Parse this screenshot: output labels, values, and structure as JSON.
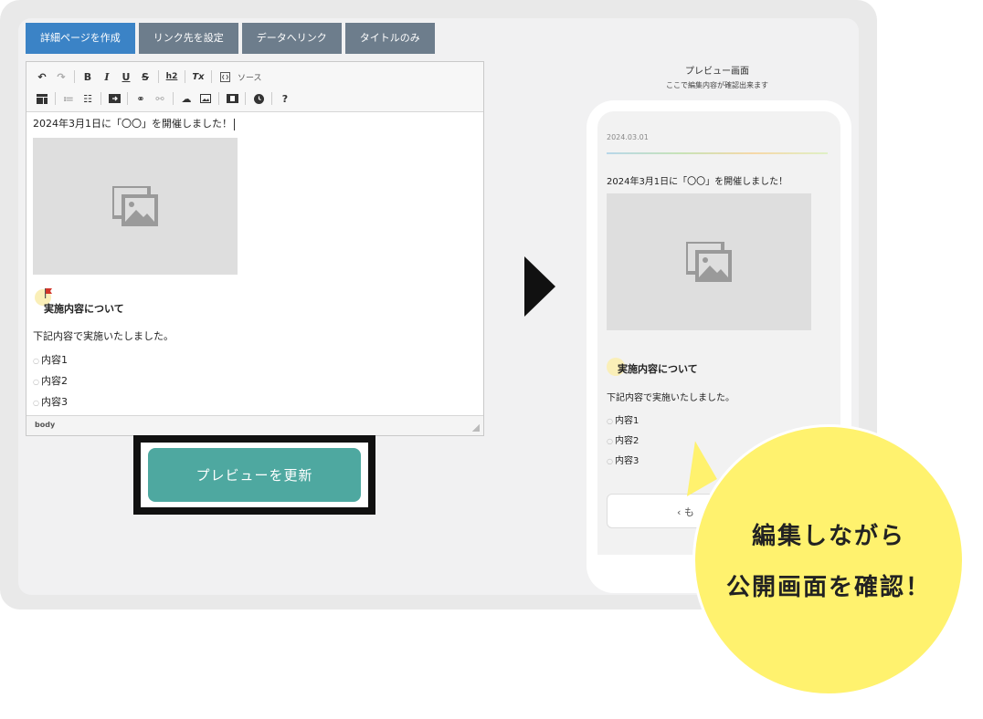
{
  "tabs": [
    {
      "label": "詳細ページを作成",
      "active": true
    },
    {
      "label": "リンク先を設定",
      "active": false
    },
    {
      "label": "データへリンク",
      "active": false
    },
    {
      "label": "タイトルのみ",
      "active": false
    }
  ],
  "toolbar": {
    "bold": "B",
    "italic": "I",
    "underline": "U",
    "strike": "S",
    "h2": "h2",
    "clear_format": "Tx",
    "source_label": "ソース",
    "help": "?"
  },
  "editor": {
    "line1": "2024年3月1日に「〇〇」を開催しました！",
    "heading": "実施内容について",
    "paragraph": "下記内容で実施いたしました。",
    "items": [
      "内容1",
      "内容2",
      "内容3"
    ],
    "status": "body"
  },
  "update_button": "プレビューを更新",
  "preview": {
    "title": "プレビュー画面",
    "subtitle": "ここで編集内容が確認出来ます",
    "date": "2024.03.01",
    "line1": "2024年3月1日に「〇〇」を開催しました！",
    "heading": "実施内容について",
    "paragraph": "下記内容で実施いたしました。",
    "items": [
      "内容1",
      "内容2",
      "内容3"
    ],
    "back_label": "‹  も"
  },
  "bubble": {
    "line1": "編集しながら",
    "line2": "公開画面を確認！",
    "color": "#fff26e"
  },
  "colors": {
    "tab_active": "#3b83c6",
    "tab_inactive": "#6d7d8c",
    "update_button": "#4ea8a0"
  }
}
